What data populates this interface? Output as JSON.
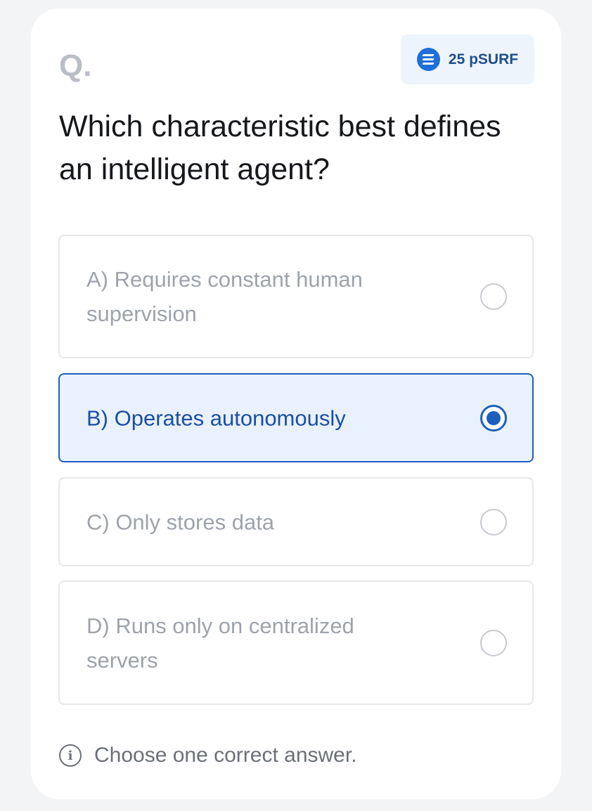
{
  "question_label": "Q.",
  "reward": {
    "icon": "coin-icon",
    "text": "25 pSURF",
    "accent": "#1e6fd9"
  },
  "question": "Which characteristic best defines an intelligent agent?",
  "options": [
    {
      "label": "A) Requires constant human supervision",
      "selected": false
    },
    {
      "label": "B) Operates autonomously",
      "selected": true
    },
    {
      "label": "C) Only stores data",
      "selected": false
    },
    {
      "label": "D) Runs only on centralized servers",
      "selected": false
    }
  ],
  "hint": {
    "icon": "info-icon",
    "text": "Choose one correct answer."
  },
  "colors": {
    "selected_border": "#1d5fbd",
    "selected_bg": "#e9f1fc"
  }
}
